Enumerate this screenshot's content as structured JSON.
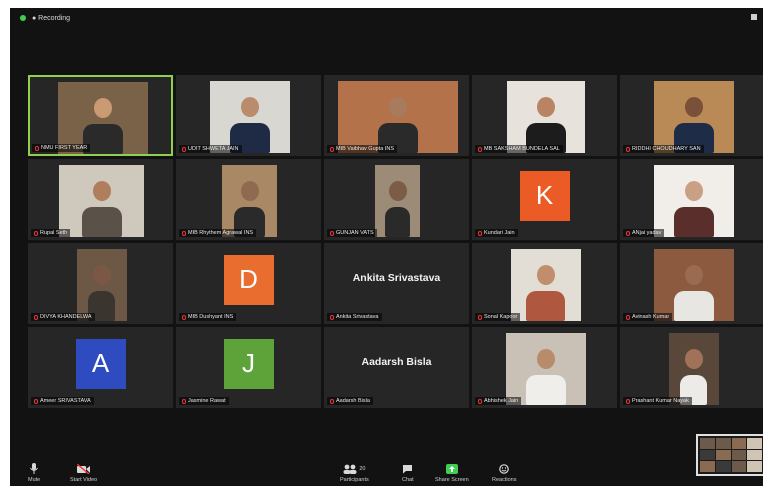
{
  "topbar": {
    "recording_label": "● Recording"
  },
  "participants": [
    {
      "name": "NMU FIRST YEAR",
      "type": "video",
      "active": true,
      "bg": "#7a6248",
      "head": "#c99a74",
      "shirt": "#2a2a2a"
    },
    {
      "name": "UDIT SHWETA JAIN",
      "type": "video",
      "bg": "#d9d7d2",
      "head": "#b98c6b",
      "shirt": "#1f2a44"
    },
    {
      "name": "MIB Vaibhav Gupta INS",
      "type": "video",
      "bg": "#b4724a",
      "head": "#a87a5e",
      "shirt": "#2a2a2a"
    },
    {
      "name": "MB SAKSHAM BUNDELA SAL",
      "type": "video",
      "bg": "#e7e3dc",
      "head": "#b98463",
      "shirt": "#1c1c1c"
    },
    {
      "name": "RIDDHI CHOUDHARY SAN",
      "type": "video",
      "bg": "#b98956",
      "head": "#7b5038",
      "shirt": "#1f2c48"
    },
    {
      "name": "Rupal Seth",
      "type": "video",
      "bg": "#cfc8bc",
      "head": "#b07e5d",
      "shirt": "#5a5148"
    },
    {
      "name": "MIB Rhythem Agrawal INS",
      "type": "video",
      "bg": "#a98866",
      "head": "#8f6a50",
      "shirt": "#2a2a2a"
    },
    {
      "name": "GUNJAN VATS",
      "type": "video",
      "bg": "#9c8b77",
      "head": "#7d5c47",
      "shirt": "#2a2a2a"
    },
    {
      "name": "Kundari Jain",
      "type": "avatar",
      "letter": "K",
      "color": "#ea5b25"
    },
    {
      "name": "ANjai yadav",
      "type": "video",
      "bg": "#f1ede8",
      "head": "#caa084",
      "shirt": "#5a2e2a"
    },
    {
      "name": "DIVYA KHANDELWA",
      "type": "video",
      "bg": "#6c5845",
      "head": "#7a5845",
      "shirt": "#3b3530"
    },
    {
      "name": "MIB Dushyant INS",
      "type": "avatar",
      "letter": "D",
      "color": "#e96d2e"
    },
    {
      "name": "Ankita Srivastava",
      "type": "name",
      "display": "Ankita Srivastava"
    },
    {
      "name": "Sonal Kapoor",
      "type": "video",
      "bg": "#e2ddd5",
      "head": "#c08d6d",
      "shirt": "#b0573f"
    },
    {
      "name": "Avinash Kumar",
      "type": "video",
      "bg": "#8c5a3e",
      "head": "#9a6b50",
      "shirt": "#e8e6e2"
    },
    {
      "name": "Ameer SRIVASTAVA",
      "type": "avatar",
      "letter": "A",
      "color": "#2e4bbf"
    },
    {
      "name": "Jasmine Rawat",
      "type": "avatar",
      "letter": "J",
      "color": "#5ea33a"
    },
    {
      "name": "Aadarsh Bisla",
      "type": "name",
      "display": "Aadarsh Bisla"
    },
    {
      "name": "Abhishek Jain",
      "type": "video",
      "bg": "#c9c1b6",
      "head": "#b88b6a",
      "shirt": "#efeeea"
    },
    {
      "name": "Prashant Kumar Nayak",
      "type": "video",
      "bg": "#59473a",
      "head": "#a07257",
      "shirt": "#ecebe7"
    }
  ],
  "toolbar": {
    "mute": "Mute",
    "video": "Start Video",
    "participants": "Participants",
    "participants_count": "20",
    "chat": "Chat",
    "share": "Share Screen",
    "reactions": "Reactions"
  }
}
